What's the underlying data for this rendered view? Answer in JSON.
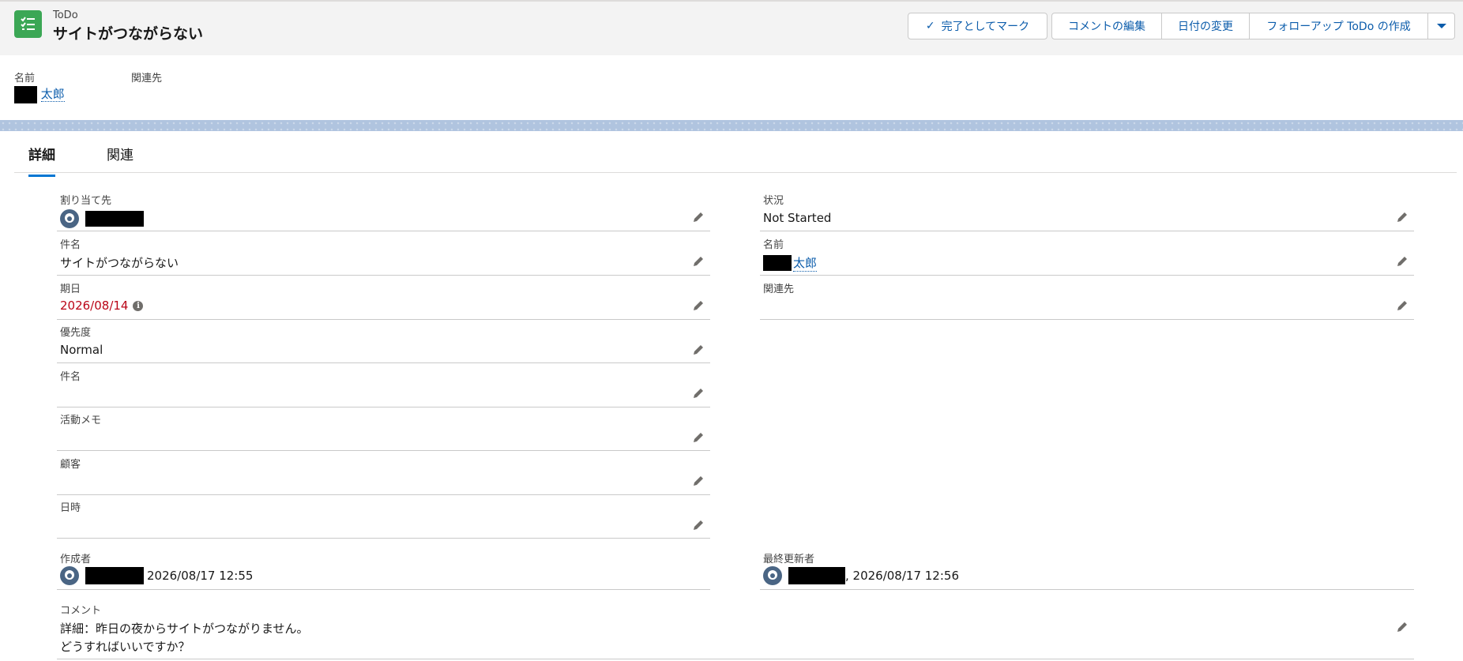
{
  "header": {
    "object_label": "ToDo",
    "title": "サイトがつながらない",
    "buttons": {
      "mark_complete": "完了としてマーク",
      "edit_comment": "コメントの編集",
      "change_date": "日付の変更",
      "follow_up": "フォローアップ ToDo の作成"
    }
  },
  "highlights": {
    "name_label": "名前",
    "name_value": "太郎",
    "related_label": "関連先"
  },
  "tabs": {
    "details": "詳細",
    "related": "関連"
  },
  "fields": {
    "assigned_to": {
      "label": "割り当て先"
    },
    "subject": {
      "label": "件名",
      "value": "サイトがつながらない"
    },
    "due_date": {
      "label": "期日",
      "value": "2026/08/14"
    },
    "priority": {
      "label": "優先度",
      "value": "Normal"
    },
    "subject2": {
      "label": "件名"
    },
    "activity_memo": {
      "label": "活動メモ"
    },
    "customer": {
      "label": "顧客"
    },
    "datetime": {
      "label": "日時"
    },
    "status": {
      "label": "状況",
      "value": "Not Started"
    },
    "name": {
      "label": "名前",
      "value": "太郎"
    },
    "related_to": {
      "label": "関連先"
    },
    "created_by": {
      "label": "作成者",
      "value": "2026/08/17 12:55"
    },
    "last_modified_by": {
      "label": "最終更新者",
      "value": ", 2026/08/17 12:56"
    },
    "comment": {
      "label": "コメント",
      "line1": "詳細：昨日の夜からサイトがつながりません。",
      "line2": "どうすればいいですか？"
    }
  },
  "colors": {
    "accent": "#0176d3",
    "link": "#0b5cab",
    "app_icon": "#3ba755",
    "overdue": "#ba0517"
  },
  "icons": [
    "task-list-icon",
    "checkmark-icon",
    "chevron-down-icon",
    "pencil-icon",
    "user-avatar-icon",
    "info-icon"
  ]
}
